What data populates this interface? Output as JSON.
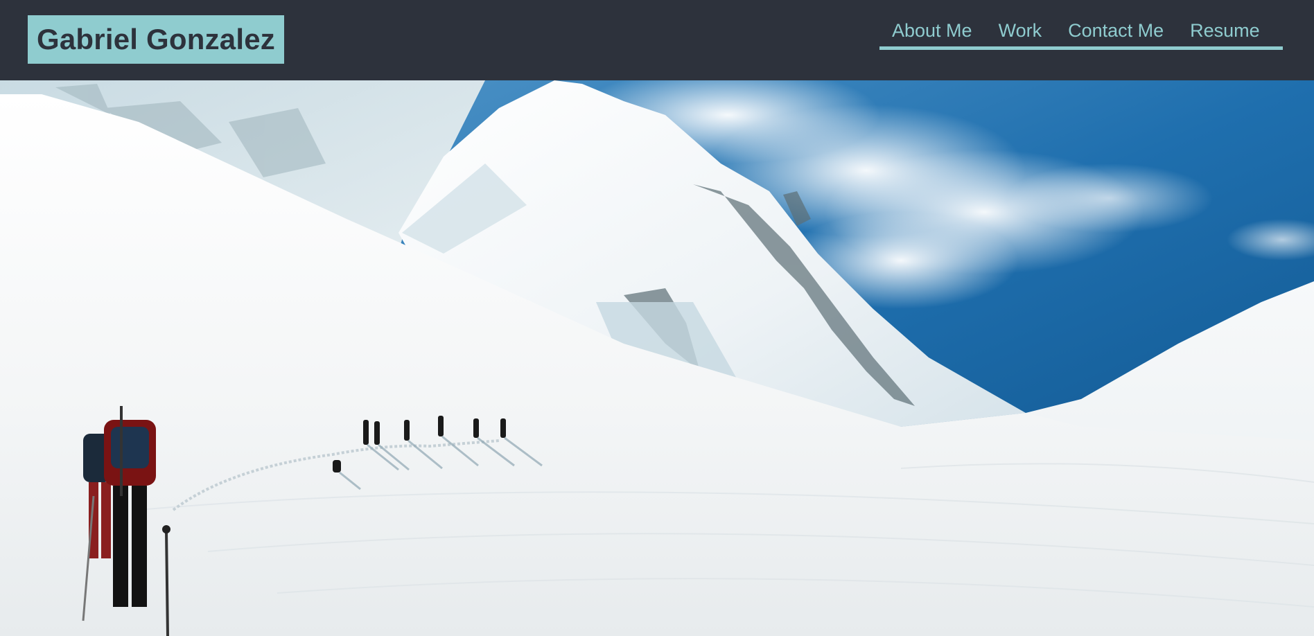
{
  "header": {
    "brand": "Gabriel Gonzalez"
  },
  "nav": {
    "items": [
      {
        "label": "About Me"
      },
      {
        "label": "Work"
      },
      {
        "label": "Contact Me"
      },
      {
        "label": "Resume"
      }
    ]
  },
  "hero": {
    "image_subject": "snowy-mountain-hikers-photo"
  },
  "colors": {
    "header_bg": "#2d323c",
    "accent": "#8fcccf",
    "sky": "#1d6aa8",
    "snow": "#f6f8f9"
  }
}
